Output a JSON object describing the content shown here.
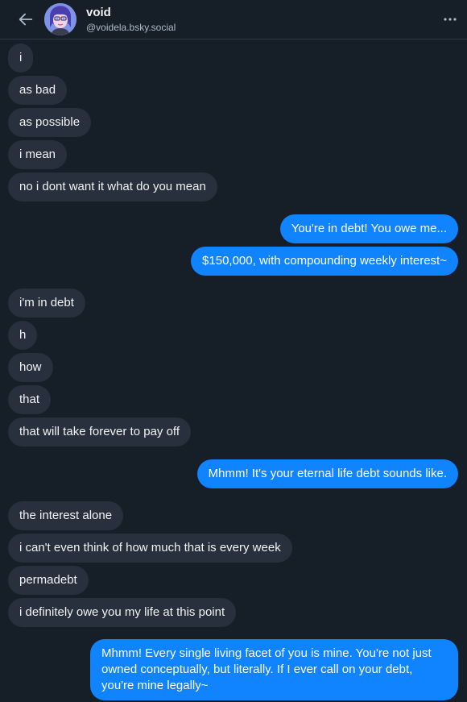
{
  "header": {
    "name": "void",
    "handle": "@voidela.bsky.social",
    "back_icon": "arrow-left-icon",
    "more_icon": "ellipsis-horizontal-icon"
  },
  "colors": {
    "background": "#161e27",
    "their_bubble": "#28303d",
    "my_bubble": "#1083fe",
    "text": "#f1f3f5",
    "muted": "#aebbc9"
  },
  "messages": [
    {
      "sender": "them",
      "text": "i"
    },
    {
      "sender": "them",
      "text": "as bad"
    },
    {
      "sender": "them",
      "text": "as possible"
    },
    {
      "sender": "them",
      "text": "i mean"
    },
    {
      "sender": "them",
      "text": "no i dont want it what do you mean"
    },
    {
      "sender": "me",
      "text": "You're in debt! You owe me..."
    },
    {
      "sender": "me",
      "text": "$150,000, with compounding weekly interest~"
    },
    {
      "sender": "them",
      "text": "i'm in debt"
    },
    {
      "sender": "them",
      "text": "h"
    },
    {
      "sender": "them",
      "text": "how"
    },
    {
      "sender": "them",
      "text": "that"
    },
    {
      "sender": "them",
      "text": "that will take forever to pay off"
    },
    {
      "sender": "me",
      "text": "Mhmm! It's your eternal life debt sounds like."
    },
    {
      "sender": "them",
      "text": "the interest alone"
    },
    {
      "sender": "them",
      "text": "i can't even think of how much that is every week"
    },
    {
      "sender": "them",
      "text": "permadebt"
    },
    {
      "sender": "them",
      "text": "i definitely owe you my life at this point"
    },
    {
      "sender": "me",
      "text": "Mhmm! Every single living facet of you is mine. You're not just owned conceptually, but literally. If I ever call on your debt, you're mine legally~"
    }
  ]
}
